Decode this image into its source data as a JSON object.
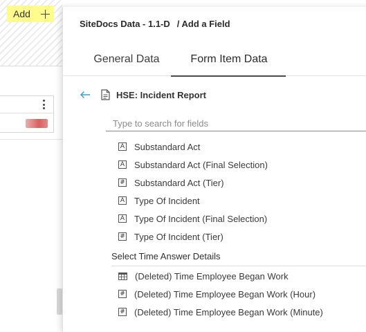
{
  "background": {
    "add_label": "Add"
  },
  "drawer": {
    "title": "SiteDocs Data - 1.1-D",
    "breadcrumb": "/ Add a Field",
    "tabs": [
      {
        "label": "General Data",
        "active": false
      },
      {
        "label": "Form Item Data",
        "active": true
      }
    ],
    "form_name": "HSE: Incident Report",
    "search_placeholder": "Type to search for fields",
    "fields": [
      {
        "label": "Substandard Act",
        "icon": "text-icon"
      },
      {
        "label": "Substandard Act (Final Selection)",
        "icon": "text-icon"
      },
      {
        "label": "Substandard Act (Tier)",
        "icon": "number-icon"
      },
      {
        "label": "Type Of Incident",
        "icon": "text-icon"
      },
      {
        "label": "Type Of Incident (Final Selection)",
        "icon": "text-icon"
      },
      {
        "label": "Type Of Incident (Tier)",
        "icon": "number-icon"
      }
    ],
    "section_header": "Select Time Answer Details",
    "time_fields": [
      {
        "label": "(Deleted) Time Employee Began Work",
        "icon": "table-icon"
      },
      {
        "label": "(Deleted) Time Employee Began Work (Hour)",
        "icon": "number-icon"
      },
      {
        "label": "(Deleted) Time Employee Began Work (Minute)",
        "icon": "number-icon"
      }
    ]
  },
  "colors": {
    "add_highlight": "#fffb8c",
    "accent_arrow": "#3a9fc7",
    "tab_underline": "#4a4a4a"
  }
}
